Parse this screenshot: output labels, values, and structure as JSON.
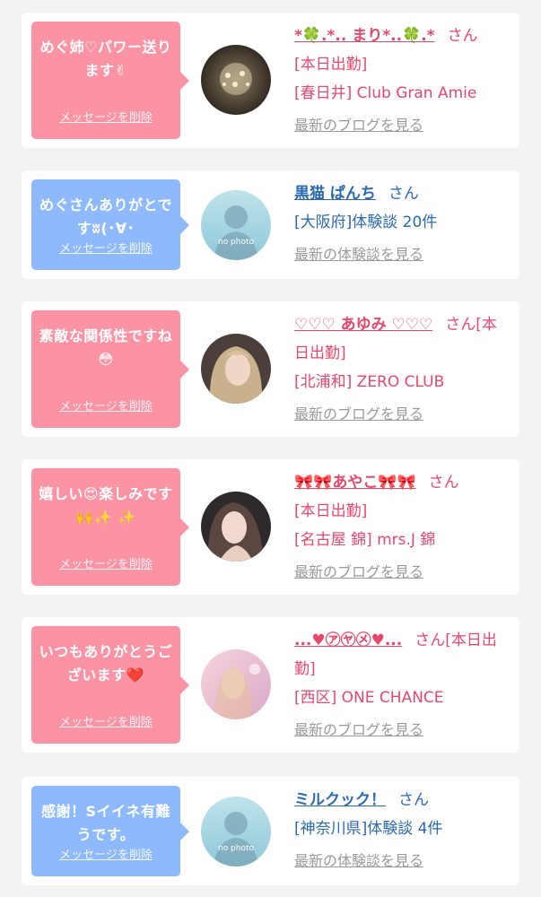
{
  "messages": [
    {
      "theme": "pink",
      "message": "めぐ姉♡パワー送ります✌",
      "delete_label": "メッセージを削除",
      "name": "*🍀.*.. まり*..🍀.*",
      "honorific": "さん",
      "status": "[本日出勤]",
      "detail": "[春日井] Club Gran Amie",
      "link": "最新のブログを見る",
      "avatar": "chandelier-photo"
    },
    {
      "theme": "blue",
      "message": "めぐさんありがとですʬ(･∀･",
      "delete_label": "メッセージを削除",
      "name": "黒猫 ぱんち",
      "honorific": "さん",
      "status": "",
      "detail": "[大阪府]体験談 20件",
      "link": "最新の体験談を見る",
      "avatar": "no-photo"
    },
    {
      "theme": "pink",
      "message": "素敵な関係性ですね😳",
      "delete_label": "メッセージを削除",
      "name": "♡♡♡ あゆみ ♡♡♡",
      "honorific": "さん",
      "status": "[本日出勤]",
      "detail": "[北浦和] ZERO CLUB",
      "link": "最新のブログを見る",
      "avatar": "portrait-photo"
    },
    {
      "theme": "pink",
      "message": "嬉しい😍楽しみです🙌✨ ✨",
      "delete_label": "メッセージを削除",
      "name": "🎀🎀あやこ🎀🎀",
      "honorific": "さん",
      "status": "[本日出勤]",
      "detail": "[名古屋 錦] mrs.J 錦",
      "link": "最新のブログを見る",
      "avatar": "portrait-photo"
    },
    {
      "theme": "pink",
      "message": "いつもありがとうございます❤️",
      "delete_label": "メッセージを削除",
      "name": "...♥㋐㋳㋱♥...",
      "honorific": "さん",
      "status": "[本日出勤]",
      "detail": "[西区] ONE CHANCE",
      "link": "最新のブログを見る",
      "avatar": "pink-photo"
    },
    {
      "theme": "blue",
      "message": "感謝！Sイイネ有難うです。",
      "delete_label": "メッセージを削除",
      "name": "ミルクック！",
      "honorific": "さん",
      "status": "",
      "detail": "[神奈川県]体験談 4件",
      "link": "最新の体験談を見る",
      "avatar": "no-photo"
    }
  ],
  "no_photo_label": "no photo",
  "colors": {
    "pink_bubble": "#fb93a5",
    "blue_bubble": "#8eb9fc",
    "pink_text": "#e8476c",
    "blue_text": "#2a6ab0",
    "link_gray": "#9a9a9a",
    "background": "#f3f3f3"
  }
}
